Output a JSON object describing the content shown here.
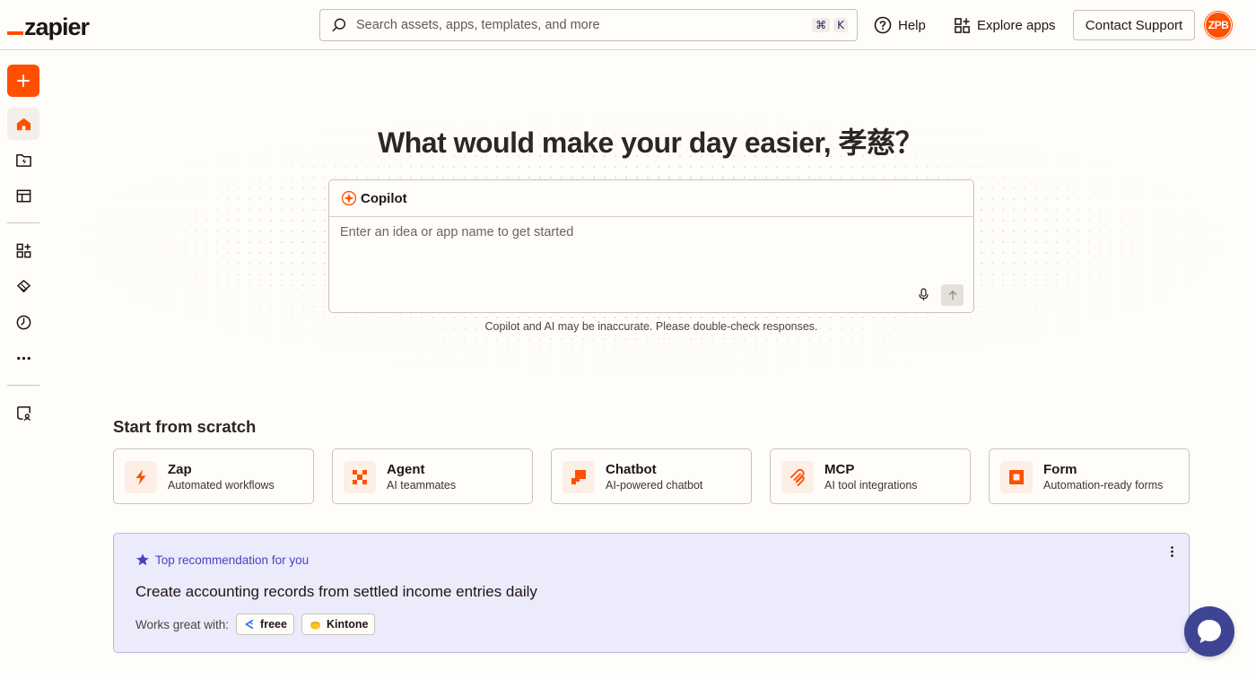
{
  "header": {
    "logo_text": "zapier",
    "search_placeholder": "Search assets, apps, templates, and more",
    "search_shortcut_cmd": "⌘",
    "search_shortcut_key": "K",
    "help_label": "Help",
    "explore_label": "Explore apps",
    "contact_label": "Contact Support",
    "avatar_initials": "ZPB"
  },
  "sidebar": {
    "items": [
      {
        "name": "home",
        "icon": "home-icon",
        "active": true
      },
      {
        "name": "zaps",
        "icon": "zap-folder-icon"
      },
      {
        "name": "tables",
        "icon": "table-icon"
      },
      {
        "name": "apps",
        "icon": "apps-icon"
      },
      {
        "name": "canvas",
        "icon": "canvas-icon"
      },
      {
        "name": "history",
        "icon": "history-icon"
      },
      {
        "name": "more",
        "icon": "more-icon"
      },
      {
        "name": "admin",
        "icon": "admin-icon"
      }
    ]
  },
  "hero": {
    "title": "What would make your day easier, 孝慈？",
    "copilot_label": "Copilot",
    "input_placeholder": "Enter an idea or app name to get started",
    "disclaimer": "Copilot and AI may be inaccurate. Please double-check responses."
  },
  "scratch": {
    "title": "Start from scratch",
    "cards": [
      {
        "title": "Zap",
        "subtitle": "Automated workflows",
        "icon": "zap-icon"
      },
      {
        "title": "Agent",
        "subtitle": "AI teammates",
        "icon": "agent-icon"
      },
      {
        "title": "Chatbot",
        "subtitle": "AI-powered chatbot",
        "icon": "chatbot-icon"
      },
      {
        "title": "MCP",
        "subtitle": "AI tool integrations",
        "icon": "mcp-icon"
      },
      {
        "title": "Form",
        "subtitle": "Automation-ready forms",
        "icon": "form-icon"
      }
    ]
  },
  "recommendation": {
    "label": "Top recommendation for you",
    "title": "Create accounting records from settled income entries daily",
    "works_with_label": "Works great with:",
    "apps": [
      "freee",
      "Kintone"
    ]
  },
  "colors": {
    "brand": "#ff4f00",
    "accent_purple": "#4b40c7",
    "chat_fab": "#3d4592"
  }
}
